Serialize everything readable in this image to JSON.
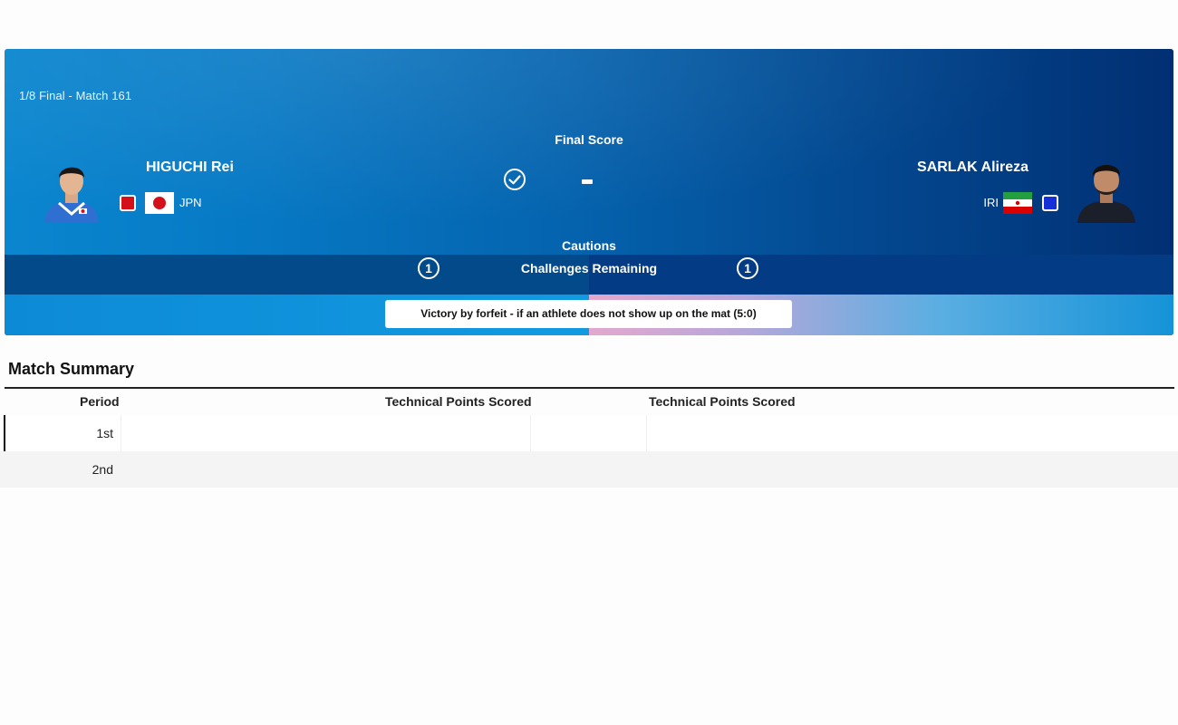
{
  "match": {
    "round_label": "1/8 Final - Match 161",
    "final_score_label": "Final Score",
    "score_text": "-",
    "cautions_label": "Cautions",
    "challenges_label": "Challenges Remaining",
    "result_text": "Victory by forfeit - if an athlete does not show up on the mat (5:0)"
  },
  "athletes": {
    "left": {
      "name": "HIGUCHI Rei",
      "country": "JPN",
      "corner": "red",
      "corner_color": "#d4101b",
      "challenges": "1"
    },
    "right": {
      "name": "SARLAK Alireza",
      "country": "IRI",
      "corner": "blue",
      "corner_color": "#1530d8",
      "challenges": "1"
    }
  },
  "summary": {
    "title": "Match Summary",
    "columns": [
      "Period",
      "Technical Points Scored",
      "Technical Points Scored"
    ],
    "rows": [
      {
        "period": "1st"
      },
      {
        "period": "2nd"
      }
    ]
  },
  "icons": {
    "check": "check-circle-icon",
    "challenge": "circled-number-icon"
  }
}
